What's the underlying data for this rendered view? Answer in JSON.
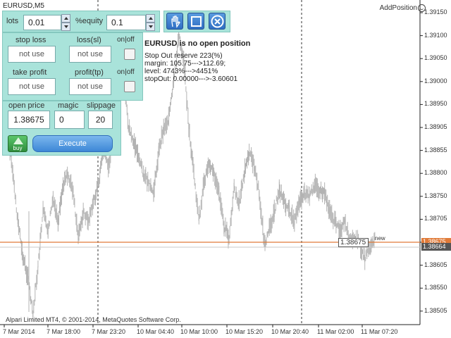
{
  "window": {
    "title": "EURUSD,M5",
    "add_position": "AddPosition"
  },
  "panel": {
    "lots_label": "lots",
    "lots_value": "0.01",
    "equity_label": "%equity",
    "equity_value": "0.1",
    "stop_loss_label": "stop loss",
    "loss_sl_label": "loss(sl)",
    "onoff1_label": "on|off",
    "stop_loss_value": "not use",
    "loss_sl_value": "not use",
    "take_profit_label": "take profit",
    "profit_tp_label": "profit(tp)",
    "onoff2_label": "on|off",
    "take_profit_value": "not use",
    "profit_tp_value": "not use",
    "open_price_label": "open price",
    "magic_label": "magic",
    "slippage_label": "slippage",
    "open_price_value": "1.38675",
    "magic_value": "0",
    "slippage_value": "20",
    "buy_label": "buy",
    "execute_label": "Execute",
    "icons": [
      "hand-icon",
      "square-icon",
      "close-circle-icon",
      "up-arrow-icon"
    ]
  },
  "info": {
    "title": "EURUSD is no open position",
    "lines": [
      "Stop Out reserve 223(%)",
      "margin: 105.75--->112.69;",
      "level: 4743%--->4451%",
      "stopOut: 0.00000--->-3.60601"
    ]
  },
  "chart": {
    "price_labels": [
      "1.39150",
      "1.39100",
      "1.39050",
      "1.39000",
      "1.38950",
      "1.38905",
      "1.38855",
      "1.38800",
      "1.38750",
      "1.38705",
      "1.38655",
      "1.38605",
      "1.38550",
      "1.38505"
    ],
    "time_labels": [
      "7 Mar 2014",
      "7 Mar 18:00",
      "7 Mar 23:20",
      "10 Mar 04:40",
      "10 Mar 10:00",
      "10 Mar 15:20",
      "10 Mar 20:40",
      "11 Mar 02:00",
      "11 Mar 07:20"
    ],
    "ask_price": "1.38675",
    "bid_price": "1.38664",
    "trade_box_value": "1.38675",
    "new_label": "new",
    "copyright": "Alpari Limited MT4, © 2001-2014, MetaQuotes Software Corp.",
    "colors": {
      "ask_line": "#e07b39",
      "bid_line": "#c9c9c9",
      "candles": "#b3b3b3",
      "ask_tag": "#e07b39",
      "bid_tag": "#555555"
    }
  },
  "chart_data": {
    "type": "line",
    "title": "EURUSD,M5",
    "series": [
      {
        "values": [
          1.3896,
          1.389,
          1.388,
          1.387,
          1.3862,
          1.3858,
          1.385,
          1.386,
          1.3872,
          1.3868,
          1.3875,
          1.387,
          1.3878,
          1.388,
          1.3876,
          1.3866,
          1.3872,
          1.387,
          1.3874,
          1.3878,
          1.3885,
          1.3882,
          1.3888,
          1.3895,
          1.3902,
          1.389,
          1.3887,
          1.3884,
          1.388,
          1.3878,
          1.3876,
          1.3885,
          1.389,
          1.3892,
          1.39,
          1.391,
          1.3905,
          1.389,
          1.388,
          1.387,
          1.3878,
          1.3883,
          1.388,
          1.3876,
          1.3869,
          1.3866,
          1.3877,
          1.3874,
          1.388,
          1.3885,
          1.3882,
          1.3876,
          1.3865,
          1.3868,
          1.3872,
          1.3877,
          1.3874,
          1.3872,
          1.387,
          1.3874,
          1.3876,
          1.3875,
          1.3878,
          1.3876,
          1.3876,
          1.3872,
          1.387,
          1.3868,
          1.387,
          1.3866,
          1.3866,
          1.3865,
          1.3862,
          1.3864,
          1.3866
        ]
      }
    ],
    "ylim": [
      1.385,
      1.392
    ]
  }
}
